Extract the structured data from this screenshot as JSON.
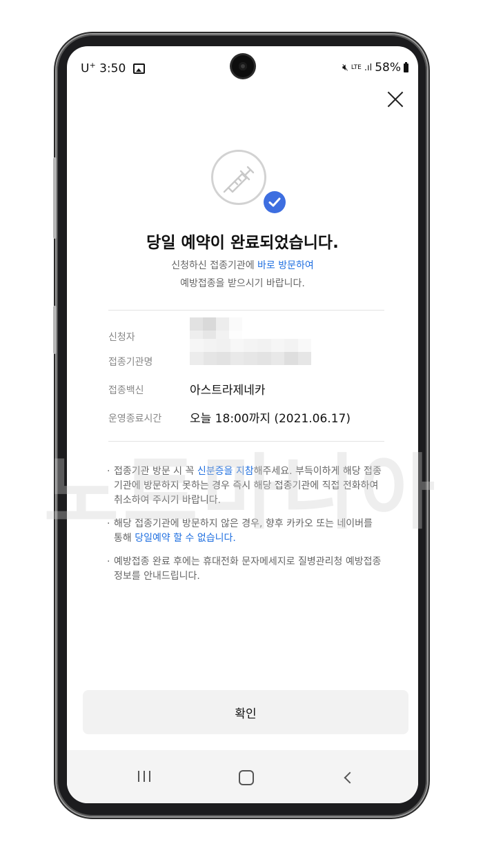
{
  "status": {
    "carrier": "U",
    "carrier_sup": "+",
    "time": "3:50",
    "network": "LTE",
    "signal": ".ıl",
    "battery": "58%"
  },
  "dialog": {
    "title": "당일 예약이 완료되었습니다.",
    "sub_line1_prefix": "신청하신 접종기관에 ",
    "sub_line1_highlight": "바로 방문하여",
    "sub_line2": "예방접종을 받으시기 바랍니다."
  },
  "details": {
    "applicant_label": "신청자",
    "institution_label": "접종기관명",
    "vaccine_label": "접종백신",
    "vaccine_value": "아스트라제네카",
    "hours_label": "운영종료시간",
    "hours_value": "오늘 18:00까지 (2021.06.17)"
  },
  "notes": [
    {
      "before": "접종기관 방문 시 꼭 ",
      "highlight": "신분증을 지참",
      "after": "해주세요. 부득이하게 해당 접종기관에 방문하지 못하는 경우 즉시 해당 접종기관에 직접 전화하여 취소하여 주시기 바랍니다."
    },
    {
      "before": "해당 접종기관에 방문하지 않은 경우, 향후 카카오 또는 네이버를 통해 ",
      "highlight": "당일예약 할 수 없습니다.",
      "after": ""
    },
    {
      "before": "예방접종 완료 후에는 휴대전화 문자메세지로 질병관리청 예방접종 정보를 안내드립니다.",
      "highlight": "",
      "after": ""
    }
  ],
  "confirm_label": "확인",
  "watermark": "노트마니아",
  "icons": {
    "close": "close-icon",
    "syringe": "syringe-icon",
    "check": "check-icon",
    "recent": "recent-apps-icon",
    "home": "home-icon",
    "back": "back-icon"
  },
  "colors": {
    "accent": "#1f6fe0",
    "check_badge": "#3d6ee0"
  }
}
